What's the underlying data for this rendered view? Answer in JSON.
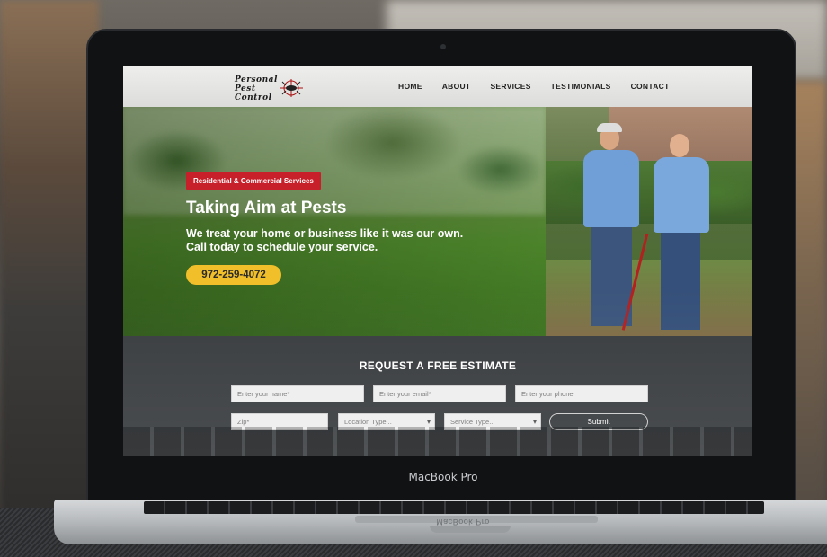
{
  "site": {
    "logo": {
      "line1": "Personal",
      "line2": "Pest",
      "line3": "Control"
    },
    "nav": [
      {
        "label": "HOME"
      },
      {
        "label": "ABOUT"
      },
      {
        "label": "SERVICES"
      },
      {
        "label": "TESTIMONIALS"
      },
      {
        "label": "CONTACT"
      }
    ]
  },
  "hero": {
    "badge": "Residential & Commercial Services",
    "headline": "Taking Aim at Pests",
    "sub_line1": "We treat your home or business like it was our own.",
    "sub_line2": "Call today to schedule your service.",
    "phone": "972-259-4072"
  },
  "estimate": {
    "title": "REQUEST A FREE ESTIMATE",
    "name_placeholder": "Enter your name*",
    "email_placeholder": "Enter your email*",
    "phone_placeholder": "Enter your phone",
    "zip_placeholder": "Zip*",
    "location_select": "Location Type...",
    "service_select": "Service Type...",
    "submit_label": "Submit"
  },
  "device": {
    "label": "MacBook Pro",
    "reflection": "MacBook Pro"
  },
  "colors": {
    "badge": "#c8202a",
    "phone_button": "#f0bf2a",
    "form_bg": "#3a3d40"
  }
}
